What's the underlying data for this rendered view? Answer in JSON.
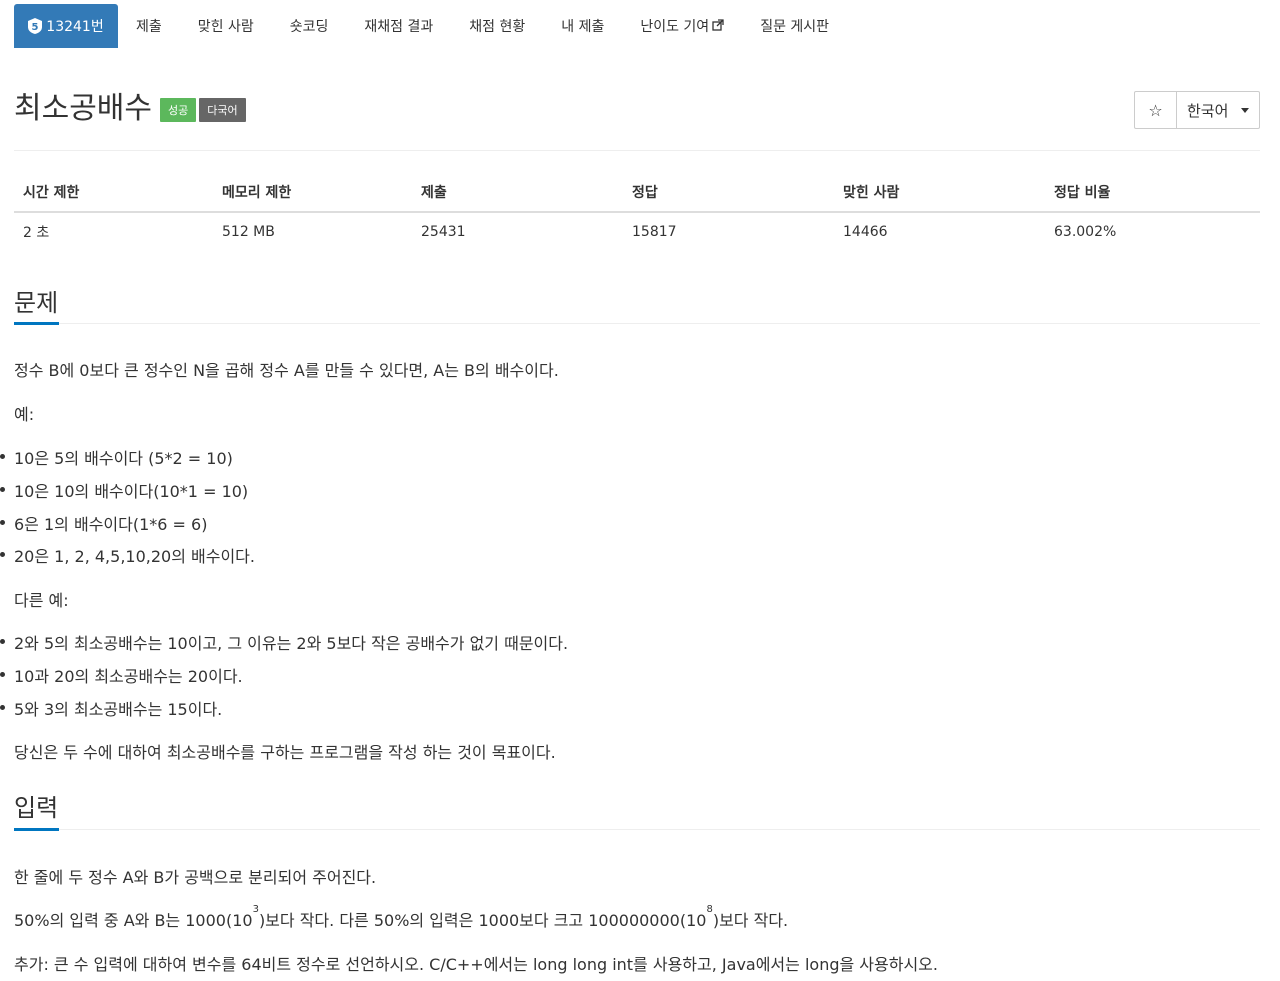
{
  "nav": {
    "problem_number": "13241번",
    "tier_badge": "5",
    "items": [
      "제출",
      "맞힌 사람",
      "숏코딩",
      "재채점 결과",
      "채점 현황",
      "내 제출",
      "난이도 기여",
      "질문 게시판"
    ]
  },
  "problem": {
    "title": "최소공배수",
    "badge_success": "성공",
    "badge_multilang": "다국어",
    "language": "한국어"
  },
  "stats": {
    "headers": [
      "시간 제한",
      "메모리 제한",
      "제출",
      "정답",
      "맞힌 사람",
      "정답 비율"
    ],
    "values": [
      "2 초",
      "512 MB",
      "25431",
      "15817",
      "14466",
      "63.002%"
    ]
  },
  "section_problem": {
    "heading": "문제",
    "intro": "정수 B에 0보다 큰 정수인 N을 곱해 정수 A를 만들 수 있다면, A는 B의 배수이다.",
    "example_label": "예:",
    "examples": [
      "10은 5의 배수이다 (5*2 = 10)",
      "10은 10의 배수이다(10*1 = 10)",
      "6은 1의 배수이다(1*6 = 6)",
      "20은 1, 2, 4,5,10,20의 배수이다."
    ],
    "other_label": "다른 예:",
    "other_examples": [
      "2와 5의 최소공배수는 10이고, 그 이유는 2와 5보다 작은 공배수가 없기 때문이다.",
      "10과 20의 최소공배수는 20이다.",
      "5와 3의 최소공배수는 15이다."
    ],
    "goal": "당신은 두 수에 대하여 최소공배수를 구하는 프로그램을 작성 하는 것이 목표이다."
  },
  "section_input": {
    "heading": "입력",
    "line1": "한 줄에 두 정수 A와 B가 공백으로 분리되어 주어진다.",
    "line2_a": "50%의 입력 중 A와 B는 1000(10",
    "line2_sup1": "3",
    "line2_b": ")보다 작다. 다른 50%의 입력은 1000보다 크고 100000000(10",
    "line2_sup2": "8",
    "line2_c": ")보다 작다.",
    "line3": "추가: 큰 수 입력에 대하여 변수를 64비트 정수로 선언하시오. C/C++에서는 long long int를 사용하고, Java에서는 long을 사용하시오."
  },
  "colors": {
    "accent": "#337ab7",
    "success": "#5cb85c",
    "multilang": "#666666",
    "section_underline": "#0076c0"
  },
  "icons": [
    "shield-tier-icon",
    "external-link-icon",
    "star-icon",
    "caret-down-icon"
  ]
}
